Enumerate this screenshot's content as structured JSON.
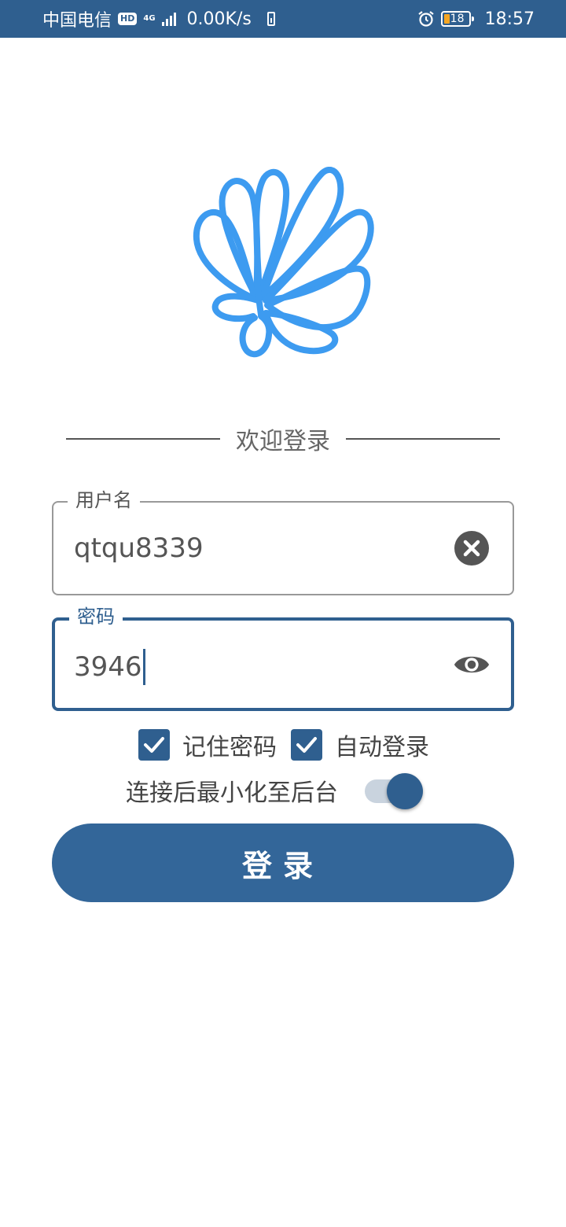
{
  "status_bar": {
    "carrier": "中国电信",
    "hd": "HD",
    "network": "4G",
    "speed": "0.00K/s",
    "battery_level": "18",
    "time": "18:57"
  },
  "welcome": {
    "text": "欢迎登录"
  },
  "username": {
    "label": "用户名",
    "value": "qtqu8339"
  },
  "password": {
    "label": "密码",
    "value": "3946"
  },
  "options": {
    "remember_password": {
      "label": "记住密码",
      "checked": true
    },
    "auto_login": {
      "label": "自动登录",
      "checked": true
    },
    "minimize": {
      "label": "连接后最小化至后台",
      "on": true
    }
  },
  "login_button": {
    "label": "登录"
  },
  "colors": {
    "primary": "#2f5f8f",
    "button": "#336699",
    "logo": "#3d9bf0"
  }
}
